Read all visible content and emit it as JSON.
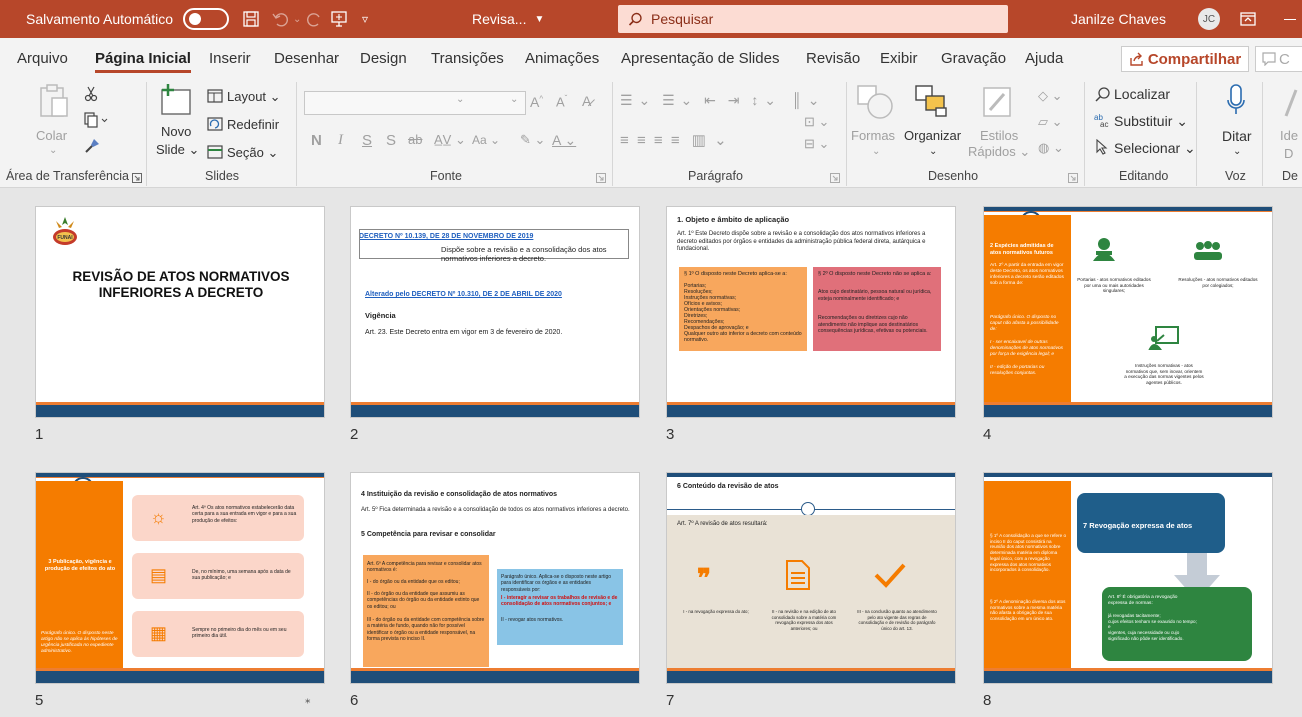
{
  "titlebar": {
    "autosave": "Salvamento Automático",
    "doc_name": "Revisa...",
    "search_placeholder": "Pesquisar",
    "user_name": "Janilze Chaves",
    "user_initials": "JC"
  },
  "tabs": [
    "Arquivo",
    "Página Inicial",
    "Inserir",
    "Desenhar",
    "Design",
    "Transições",
    "Animações",
    "Apresentação de Slides",
    "Revisão",
    "Exibir",
    "Gravação",
    "Ajuda"
  ],
  "share_label": "Compartilhar",
  "ribbon": {
    "clipboard": {
      "paste": "Colar",
      "group": "Área de Transferência"
    },
    "slides": {
      "new": "Novo",
      "slide": "Slide",
      "layout": "Layout",
      "reset": "Redefinir",
      "section": "Seção",
      "group": "Slides"
    },
    "font": {
      "group": "Fonte"
    },
    "paragraph": {
      "group": "Parágrafo"
    },
    "drawing": {
      "shapes": "Formas",
      "arrange": "Organizar",
      "styles": "Estilos",
      "quick": "Rápidos",
      "group": "Desenho"
    },
    "editing": {
      "find": "Localizar",
      "replace": "Substituir",
      "select": "Selecionar",
      "group": "Editando"
    },
    "voice": {
      "dictate": "Ditar",
      "group": "Voz"
    }
  },
  "slides": [
    {
      "num": "1",
      "title": "REVISÃO DE ATOS NORMATIVOS INFERIORES A DECRETO",
      "logo": "FUNAI"
    },
    {
      "num": "2",
      "link1": "DECRETO Nº 10.139, DE 28 DE NOVEMBRO DE 2019",
      "box": "Dispõe sobre a revisão e a consolidação dos atos normativos inferiores a decreto.",
      "link2": "Alterado pelo DECRETO Nº 10.310, DE 2 DE ABRIL DE 2020",
      "heading": "Vigência",
      "text": "Art. 23. Este Decreto entra em vigor em 3 de fevereiro de 2020."
    },
    {
      "num": "3",
      "heading": "1. Objeto e âmbito de aplicação",
      "text": "Art. 1º Este Decreto dispõe sobre a revisão e a consolidação dos atos normativos inferiores a decreto editados por órgãos e entidades da administração pública federal direta, autárquica e fundacional.",
      "left_title": "§ 1º O disposto neste Decreto aplica-se a:",
      "left_items": [
        "Portarias;",
        "Resoluções;",
        "Instruções normativas;",
        "Ofícios e avisos;",
        "Orientações normativas;",
        "Diretrizes;",
        "Recomendações;",
        "Despachos de aprovação; e",
        "Qualquer outro ato inferior a decreto com conteúdo normativo."
      ],
      "right_title": "§ 2º O disposto neste Decreto não se aplica a:",
      "right_items": [
        "Atos cujo destinatário, pessoa natural ou jurídica, esteja nominalmente identificado; e",
        "Recomendações ou diretrizes cujo não atendimento não implique aos destinatários consequências jurídicas, efetivas ou potenciais."
      ]
    },
    {
      "num": "4",
      "side": "2 Espécies admitidas de atos normativos futuros",
      "side_text": "Art. 2º A partir da entrada em vigor deste Decreto, os atos normativos inferiores a decreto serão editados sob a forma de:",
      "side_text2": "Parágrafo único. O disposto no caput não afasta a possibilidade de:",
      "side_text3": "I - ser encaixavel de outras denominações de atos normativos por força de exigência legal; e",
      "side_text4": "II - edição de portarias ou resoluções conjuntas.",
      "item1": "Portarias - atos normativos editados por uma ou mais autoridades singulares;",
      "item2": "Resoluções - atos normativos editados por colegiados;",
      "item3": "Instruções normativas - atos normativos que, sem inovar, orientem a execução das normas vigentes pelos agentes públicos."
    },
    {
      "num": "5",
      "side": "3 Publicação, vigência e produção de efeitos do ato",
      "side_text": "Parágrafo único. O disposto neste artigo não se aplica às hipóteses de urgência justificada no expediente administrativo.",
      "row1": "Art. 4º Os atos normativos estabelecerão data certa para a sua entrada em vigor e para a sua produção de efeitos:",
      "row2": "De, no mínimo, uma semana após a data de sua publicação; e",
      "row3": "Sempre no primeiro dia do mês ou em seu primeiro dia útil."
    },
    {
      "num": "6",
      "heading": "4 Instituição da revisão e consolidação de atos normativos",
      "text": "Art. 5º Fica determinada a revisão e a consolidação de todos os atos normativos inferiores a decreto.",
      "heading2": "5 Competência para revisar e consolidar",
      "left_title": "Art. 6º A competência para revisar e consolidar atos normativos é:",
      "left_items": [
        "I - do órgão ou da entidade que os editou;",
        "II - do órgão ou da entidade que assumiu as competências do órgão ou da entidade extinto que os editou; ou",
        "III - do órgão ou da entidade com competência sobre a matéria de fundo, quando não for possível identificar o órgão ou a entidade responsável, na forma prevista no inciso II."
      ],
      "right_title": "Parágrafo único. Aplica-se o disposto neste artigo para identificar os órgãos e as entidades responsáveis por:",
      "right_red": "I - interagir a revisar os trabalhos de revisão e de consolidação de atos normativos conjuntos; e",
      "right_item": "II - revogar atos normativos."
    },
    {
      "num": "7",
      "heading": "6 Conteúdo da revisão de atos",
      "text": "Art. 7º A revisão de atos resultará:",
      "c1": "I - na revogação expressa do ato;",
      "c2": "II - na revisão e na edição de ato consolidado sobre a matéria com revogação expressa dos atos anteriores; ou",
      "c3": "III - na conclusão quanto ao atendimento pelo ato vigente das regras de consolidação e de revisão do parágrafo único do art. 13."
    },
    {
      "num": "8",
      "title": "7 Revogação expressa de atos",
      "left1": "§ 1º A consolidação a que se refere o inciso II do caput consistirá na reunião dos atos normativos sobre determinada matéria em diploma legal único, com a revogação expressa dos atos normativos incorporados à consolidação.",
      "left2": "§ 2º A denominação diversa dos atos normativos sobre a mesma matéria não afasta a obrigação de sua consolidação em um único ato.",
      "green": "Art. 8º É obrigatória a revogação expressa de normas:",
      "green_items": [
        "já revogadas tacitamente;",
        "cujos efeitos tenham se exaurido no tempo; e",
        "vigentes, cuja necessidade ou cujo significado não pôde ser identificado."
      ]
    }
  ],
  "colors": {
    "accent": "#b7472a",
    "slide_orange": "#f57c00",
    "slide_blue": "#1f4e79"
  }
}
